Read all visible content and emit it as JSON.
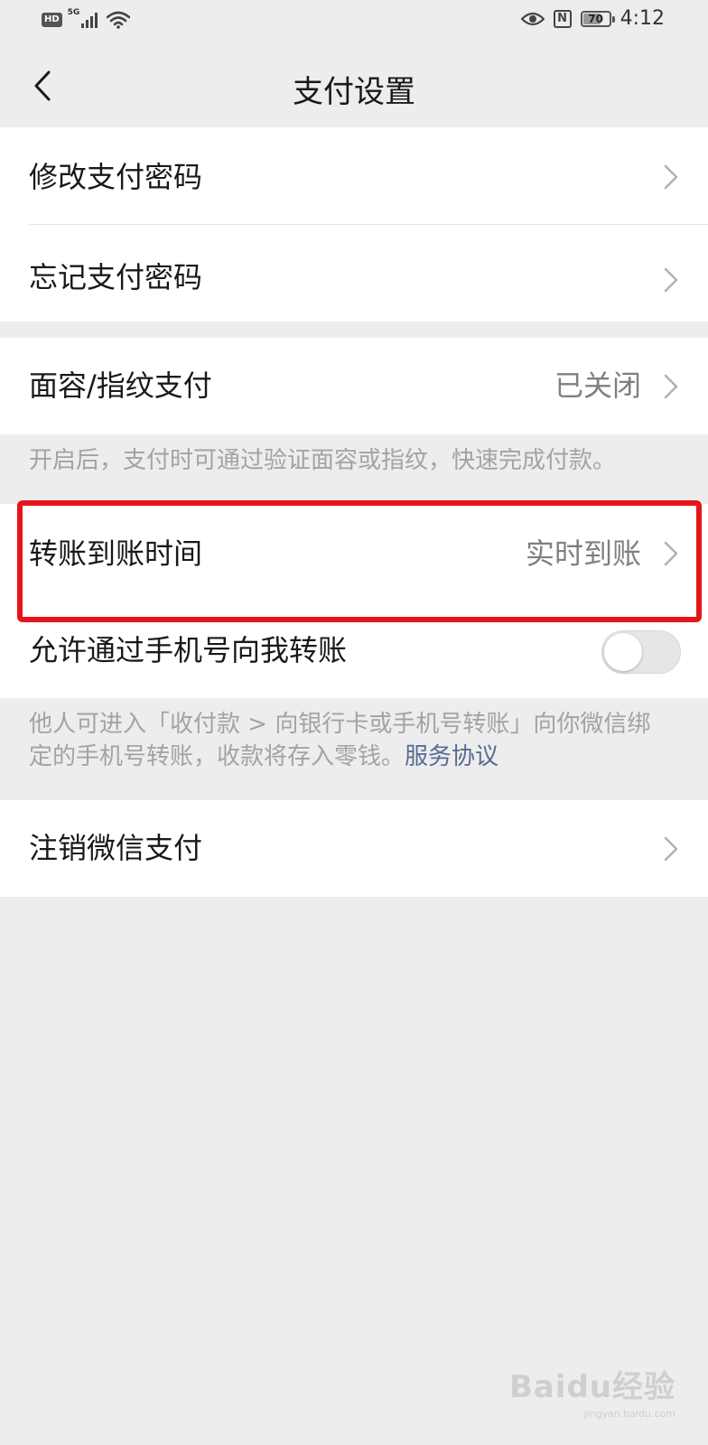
{
  "status_bar": {
    "hd": "HD",
    "network": "5G",
    "battery": "70",
    "battery_level": 0.7,
    "nfc": "N",
    "time": "4:12"
  },
  "nav": {
    "title": "支付设置"
  },
  "group1": {
    "items": [
      {
        "label": "修改支付密码"
      },
      {
        "label": "忘记支付密码"
      }
    ]
  },
  "biometric": {
    "label": "面容/指纹支付",
    "value": "已关闭",
    "tip": "开启后，支付时可通过验证面容或指纹，快速完成付款。"
  },
  "transfer": {
    "arrival_label": "转账到账时间",
    "arrival_value": "实时到账",
    "phone_label": "允许通过手机号向我转账",
    "phone_enabled": false,
    "tip_text": "他人可进入「收付款 > 向银行卡或手机号转账」向你微信绑定的手机号转账，收款将存入零钱。",
    "tip_link": "服务协议"
  },
  "cancel": {
    "label": "注销微信支付"
  },
  "watermark": {
    "main": "Baidu经验",
    "sub": "jingyan.baidu.com"
  },
  "colors": {
    "background": "#ededed",
    "link": "#576b95",
    "highlight": "#e8141b"
  }
}
